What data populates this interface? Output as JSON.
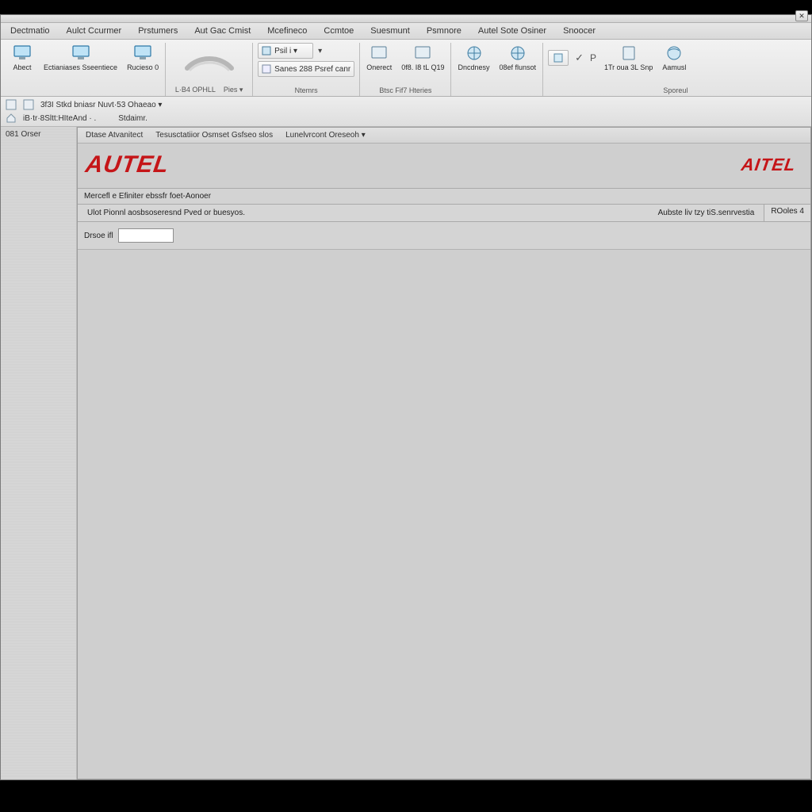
{
  "window": {
    "close_glyph": "✕"
  },
  "menubar": {
    "items": [
      "Dectmatio",
      "Aulct Ccurmer",
      "Prstumers",
      "Aut Gac Cmist",
      "Mcefineco",
      "Ccmtoe",
      "Suesmunt",
      "Psmnore",
      "Autel Sote Osiner",
      "Snoocer"
    ]
  },
  "ribbon": {
    "group0": {
      "btn0": {
        "label": "Abect"
      },
      "btn1": {
        "label": "Ectianiases Sseentiece"
      },
      "btn2": {
        "label": "Rucieso 0"
      }
    },
    "group1": {
      "sub": "L·B4 OPHLL",
      "pes": "Pies ▾"
    },
    "group2": {
      "mini_prefix": "Psil i ▾",
      "mini_text": "Sanes 288 Psref canr",
      "chev": "▾",
      "caption": "Ntemrs"
    },
    "group3": {
      "btn0": {
        "label": "Onerect"
      },
      "btn1": {
        "label": "0f8. I8 tL Q19"
      },
      "caption": "Btsc Fif7 Hteries"
    },
    "group4": {
      "btn0": {
        "label": "Dncdnesy"
      },
      "btn1": {
        "label": "08ef flunsot"
      }
    },
    "group5": {
      "check": "✓",
      "p": "P",
      "btn0": {
        "label": "1Tr oua 3L Snp"
      },
      "btn1": {
        "label": "Aamusl"
      },
      "caption": "Sporeul"
    }
  },
  "toolbar2": {
    "row0": {
      "text": "3f3I Stkd bniasr Nuvt·53 Ohaeao ▾"
    },
    "row1": {
      "text_a": "iB·tr·8Sltt:HIteAnd · .",
      "text_b": "Stdaimr."
    }
  },
  "left": {
    "label": "081 Orser"
  },
  "subtabs": {
    "items": [
      "Dtase Atvanitect",
      "Tesusctatiior Osmset Gsfseo slos",
      "Lunelvrcont Oreseoh ▾"
    ]
  },
  "brand": {
    "left": "AUTEL",
    "right": "AITEL"
  },
  "section": {
    "title": "Mercefl e Efiniter ebssfr foet-Aonoer"
  },
  "row1": {
    "left": "Ulot Pionnl aosbsoseresnd Pved or buesyos.",
    "right": "Aubste liv tzy tiS.senrvestia",
    "status": "ROoles 4"
  },
  "row2": {
    "label": "Drsoe ifl",
    "value": ""
  }
}
